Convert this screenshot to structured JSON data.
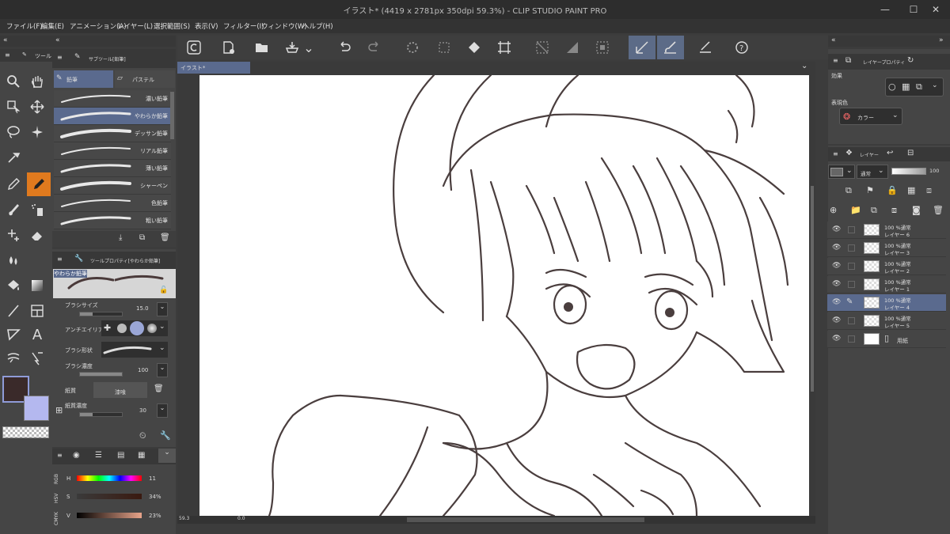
{
  "window": {
    "title": "イラスト* (4419 x 2781px 350dpi 59.3%) - CLIP STUDIO PAINT PRO"
  },
  "menu": [
    "ファイル(F)",
    "編集(E)",
    "アニメーション(A)",
    "レイヤー(L)",
    "選択範囲(S)",
    "表示(V)",
    "フィルター(I)",
    "ウィンドウ(W)",
    "ヘルプ(H)"
  ],
  "canvas_tab": "イラスト*",
  "tool_panel": {
    "tab": "ツール"
  },
  "subtool_panel": {
    "tab": "サブツール[鉛筆]",
    "tab_pencil": "鉛筆",
    "tab_pastel": "パステル",
    "brushes": [
      "濃い鉛筆",
      "やわらか鉛筆",
      "デッサン鉛筆",
      "リアル鉛筆",
      "薄い鉛筆",
      "シャーペン",
      "色鉛筆",
      "粗い鉛筆"
    ]
  },
  "property_panel": {
    "tab": "ツールプロパティ[やわらか鉛筆]",
    "preset": "やわらか鉛筆",
    "brush_size_label": "ブラシサイズ",
    "brush_size": "15.0",
    "antialias_label": "アンチエイリアス",
    "brush_shape_label": "ブラシ形状",
    "density_label": "ブラシ濃度",
    "density": "100",
    "paper_label": "紙質",
    "paper_value": "漆喰",
    "paper_density_label": "紙質濃度",
    "paper_density": "30"
  },
  "color": {
    "main": "#3a2a2a",
    "sub": "#b4b8ef"
  },
  "color_panel": {
    "h_label": "H",
    "s_label": "S",
    "v_label": "V",
    "h": "11",
    "s": "34%",
    "v": "23%",
    "rgb": "RGB",
    "hsv": "HSV",
    "cmyk": "CMYK"
  },
  "status": {
    "zoom": "59.3",
    "rotate": "0.0"
  },
  "layer_prop_panel": {
    "tab": "レイヤープロパティ",
    "effect": "効果",
    "expression": "表現色",
    "color_mode": "カラー"
  },
  "layer_panel": {
    "tab": "レイヤー",
    "blend": "通常",
    "opacity": "100",
    "layers": [
      {
        "name": "レイヤー 6",
        "info": "100 %通常",
        "selected": false
      },
      {
        "name": "レイヤー 3",
        "info": "100 %通常",
        "selected": false
      },
      {
        "name": "レイヤー 2",
        "info": "100 %通常",
        "selected": false
      },
      {
        "name": "レイヤー 1",
        "info": "100 %通常",
        "selected": false
      },
      {
        "name": "レイヤー 4",
        "info": "100 %通常",
        "selected": true
      },
      {
        "name": "レイヤー 5",
        "info": "100 %通常",
        "selected": false
      },
      {
        "name": "用紙",
        "info": "",
        "selected": false
      }
    ]
  }
}
